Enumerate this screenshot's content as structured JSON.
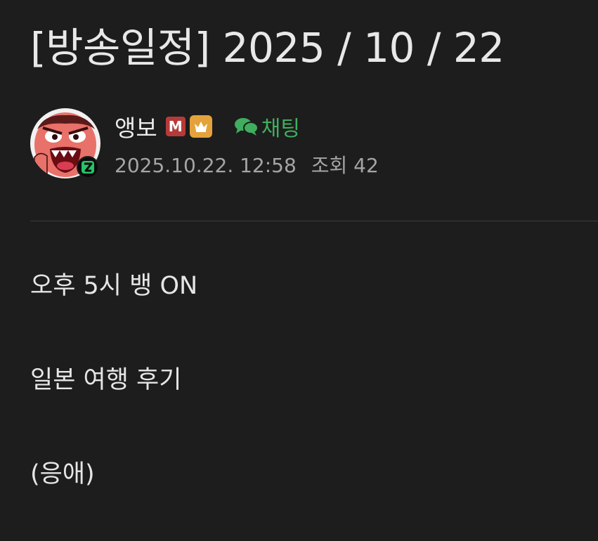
{
  "post": {
    "title": "[방송일정] 2025 / 10 / 22",
    "author": {
      "name": "앵보",
      "badge_m_label": "M",
      "badge_crown_icon": "crown-icon",
      "chat_label": "채팅",
      "chat_icon": "chat-bubbles-icon",
      "avatar_badge_label": "Z"
    },
    "meta": {
      "datetime": "2025.10.22. 12:58",
      "views_label": "조회",
      "views_count": "42"
    },
    "body_lines": [
      "오후 5시 뱅 ON",
      "일본 여행 후기",
      "(응애)"
    ]
  },
  "colors": {
    "background": "#1d1d1d",
    "text": "#e6e6e6",
    "meta_text": "#a5a5a5",
    "chat_green": "#3fae5e",
    "badge_m_red": "#b53a3a",
    "badge_crown_orange": "#e3a23b",
    "avatar_badge_green": "#27c46b"
  }
}
